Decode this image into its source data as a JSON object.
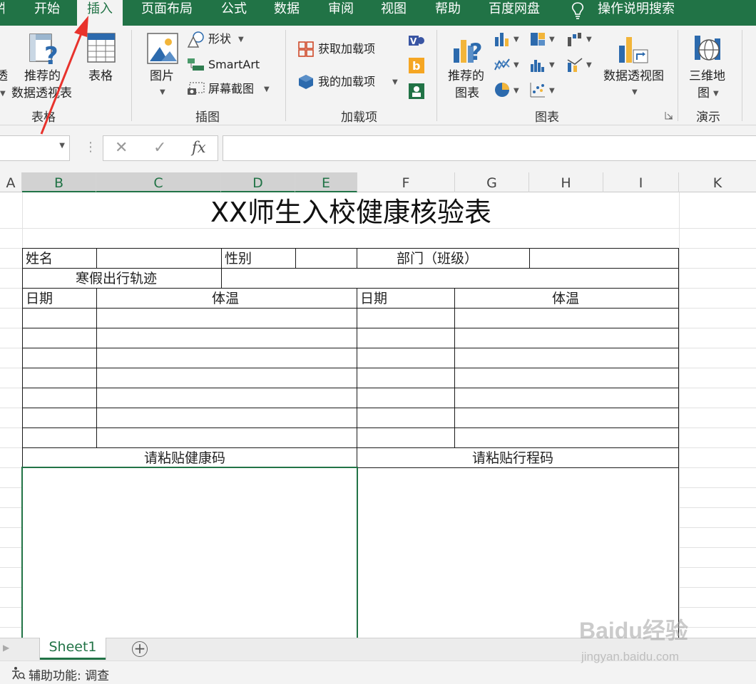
{
  "menu": {
    "edge": "件",
    "tabs": [
      "开始",
      "插入",
      "页面布局",
      "公式",
      "数据",
      "审阅",
      "视图",
      "帮助",
      "百度网盘"
    ],
    "active_tab": "插入",
    "search": "操作说明搜索"
  },
  "ribbon": {
    "tables": {
      "edge_label": "透",
      "recommended_pivot_line1": "推荐的",
      "recommended_pivot_line2": "数据透视表",
      "table": "表格",
      "group": "表格"
    },
    "illustrations": {
      "pictures": "图片",
      "shapes": "形状",
      "smartart": "SmartArt",
      "screenshot": "屏幕截图",
      "group": "插图"
    },
    "addins": {
      "get_addins": "获取加载项",
      "my_addins": "我的加载项",
      "group": "加载项"
    },
    "charts": {
      "recommended_line1": "推荐的",
      "recommended_line2": "图表",
      "pivot_chart": "数据透视图",
      "group": "图表"
    },
    "tours": {
      "map3d_line1": "三维地",
      "map3d_line2": "图",
      "group": "演示"
    }
  },
  "formula_bar": {
    "name_box": "",
    "cancel": "✕",
    "enter": "✓",
    "fx": "fx",
    "formula": ""
  },
  "columns": [
    "A",
    "B",
    "C",
    "D",
    "E",
    "F",
    "G",
    "H",
    "I",
    "K"
  ],
  "sheet": {
    "title": "XX师生入校健康核验表",
    "name_label": "姓名",
    "gender_label": "性别",
    "dept_label": "部门（班级）",
    "travel_label": "寒假出行轨迹",
    "date_label_1": "日期",
    "temp_label_1": "体温",
    "date_label_2": "日期",
    "temp_label_2": "体温",
    "health_code": "请粘贴健康码",
    "trip_code": "请粘贴行程码"
  },
  "tabs": {
    "sheet1": "Sheet1",
    "add": "+"
  },
  "status": {
    "accessibility": "辅助功能: 调查"
  },
  "watermark": {
    "main": "Baidu经验",
    "sub": "jingyan.baidu.com"
  },
  "colors": {
    "excel_green": "#217346",
    "ribbon_bg": "#f3f3f3"
  }
}
